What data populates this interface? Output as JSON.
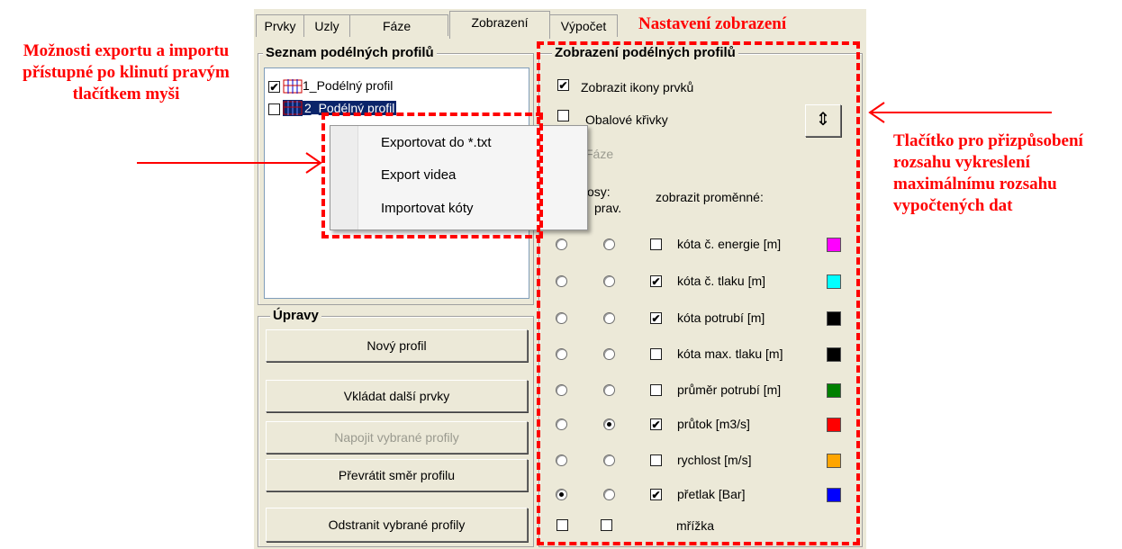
{
  "tabs": [
    {
      "label": "Prvky",
      "active": false
    },
    {
      "label": "Uzly",
      "active": false
    },
    {
      "label": "Fáze",
      "active": false
    },
    {
      "label": "Zobrazení",
      "active": true
    },
    {
      "label": "Výpočet",
      "active": false
    }
  ],
  "profile_list": {
    "title": "Seznam podélných profilů",
    "items": [
      {
        "label": "1_Podélný profil",
        "checked": true,
        "selected": false
      },
      {
        "label": "2_Podélný profil",
        "checked": false,
        "selected": true
      }
    ]
  },
  "context_menu": {
    "items": [
      "Exportovat do *.txt",
      "Export videa",
      "Importovat kóty"
    ]
  },
  "edits": {
    "title": "Úpravy",
    "buttons": [
      {
        "label": "Nový profil",
        "enabled": true
      },
      {
        "label": "Vkládat další prvky",
        "enabled": true
      },
      {
        "label": "Napojit vybrané profily",
        "enabled": false
      },
      {
        "label": "Převrátit směr profilu",
        "enabled": true
      },
      {
        "label": "Odstranit vybrané profily",
        "enabled": true
      }
    ]
  },
  "display": {
    "title": "Zobrazení podélných profilů",
    "show_icons": {
      "label": "Zobrazit ikony prvků",
      "checked": true
    },
    "envelopes": {
      "label": "Obalové křivky",
      "checked": false
    },
    "phase_label": "Fáze",
    "axes_label_1": "osy:",
    "axes_label_2": "prav.",
    "variables_header": "zobrazit proměnné:",
    "fit_button_icon": "vertical-resize-icon",
    "variables": [
      {
        "label": "kóta č. energie [m]",
        "checked": false,
        "left_radio": false,
        "right_radio": false,
        "color": "#ff00ff"
      },
      {
        "label": "kóta č. tlaku [m]",
        "checked": true,
        "left_radio": false,
        "right_radio": false,
        "color": "#00ffff"
      },
      {
        "label": "kóta potrubí [m]",
        "checked": true,
        "left_radio": false,
        "right_radio": false,
        "color": "#000000"
      },
      {
        "label": "kóta max. tlaku [m]",
        "checked": false,
        "left_radio": false,
        "right_radio": false,
        "color": "#000000"
      },
      {
        "label": "průměr potrubí [m]",
        "checked": false,
        "left_radio": false,
        "right_radio": false,
        "color": "#008000"
      },
      {
        "label": "průtok [m3/s]",
        "checked": true,
        "left_radio": false,
        "right_radio": true,
        "color": "#ff0000"
      },
      {
        "label": "rychlost [m/s]",
        "checked": false,
        "left_radio": false,
        "right_radio": false,
        "color": "#ffa500"
      },
      {
        "label": "přetlak [Bar]",
        "checked": true,
        "left_radio": true,
        "right_radio": false,
        "color": "#0000ff"
      }
    ],
    "grid": {
      "label": "mřížka",
      "left_checked": false,
      "right_checked": false
    }
  },
  "annotations": {
    "left": "Možnosti exportu a importu přístupné po klinutí pravým tlačítkem myši",
    "top": "Nastavení zobrazení",
    "right": "Tlačítko pro přizpůsobení rozsahu vykreslení maximálnímu rozsahu vypočtených dat",
    "color": "#ff0000"
  }
}
